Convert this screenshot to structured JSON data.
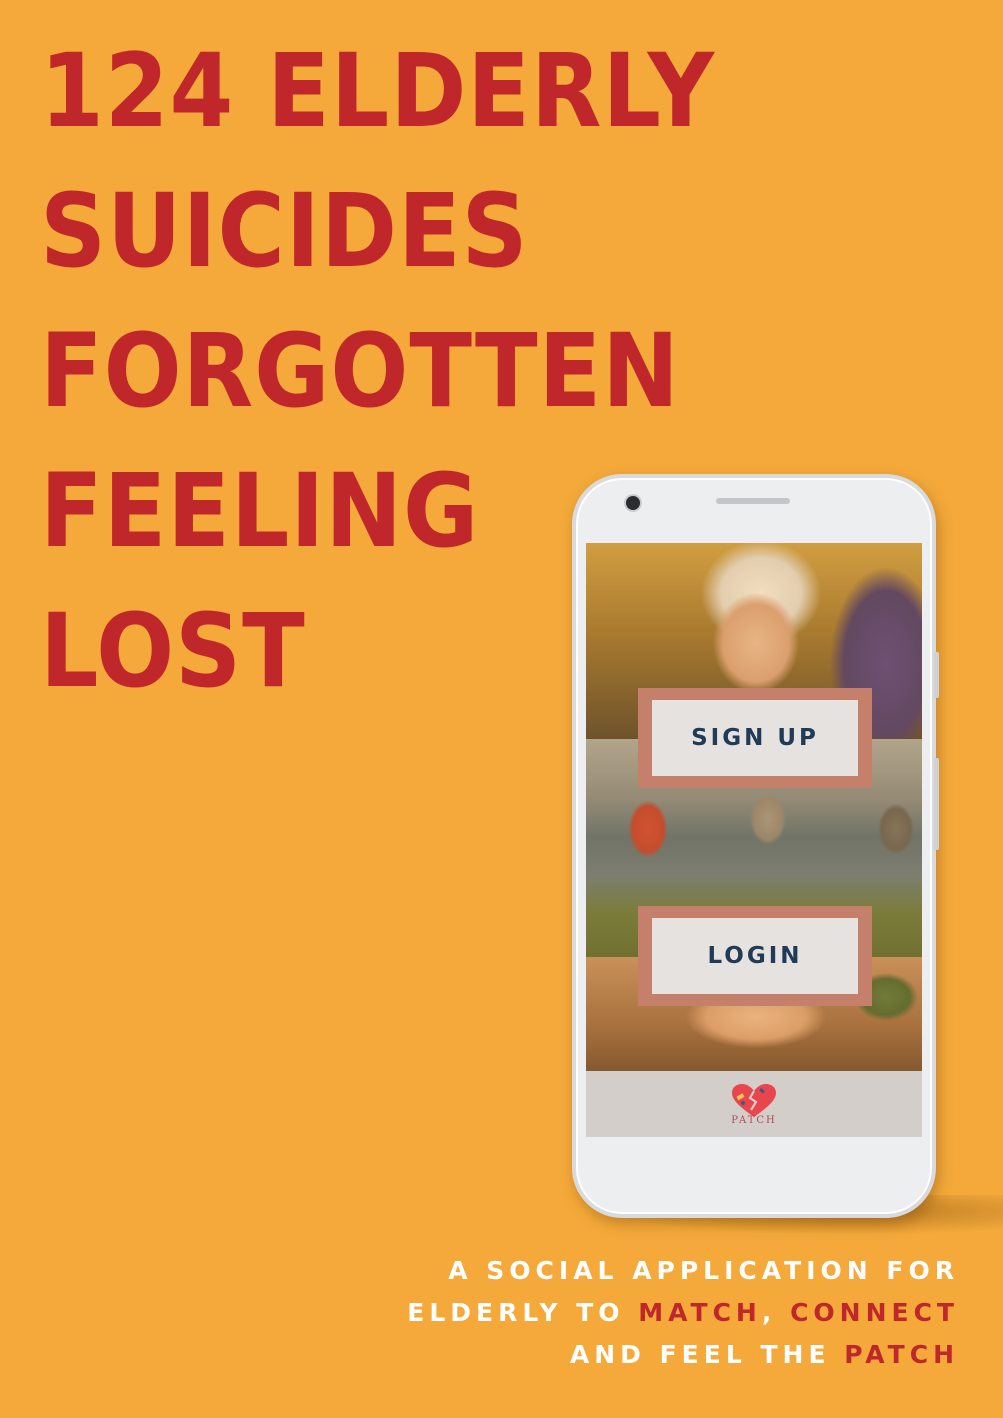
{
  "headline": {
    "lines": [
      "124 ELDERLY",
      "SUICIDES",
      "FORGOTTEN",
      "FEELING",
      "LOST"
    ]
  },
  "phone": {
    "app": {
      "signup_label": "SIGN UP",
      "login_label": "LOGIN",
      "logo_text": "PATCH",
      "logo_icon": "broken-heart-patch-icon"
    }
  },
  "tagline": {
    "line1": "A SOCIAL APPLICATION FOR",
    "line2_prefix": "ELDERLY TO ",
    "line2_match": "MATCH",
    "line2_comma": ", ",
    "line2_connect": "CONNECT",
    "line3_prefix": "AND FEEL THE ",
    "line3_patch": "PATCH"
  },
  "colors": {
    "background": "#F4A93A",
    "headline": "#C0272A",
    "button_frame": "#C4806A",
    "button_face": "#E6E2DF",
    "button_text": "#1F3B57",
    "tagline": "#FFFFFF",
    "highlight": "#C0272A"
  }
}
